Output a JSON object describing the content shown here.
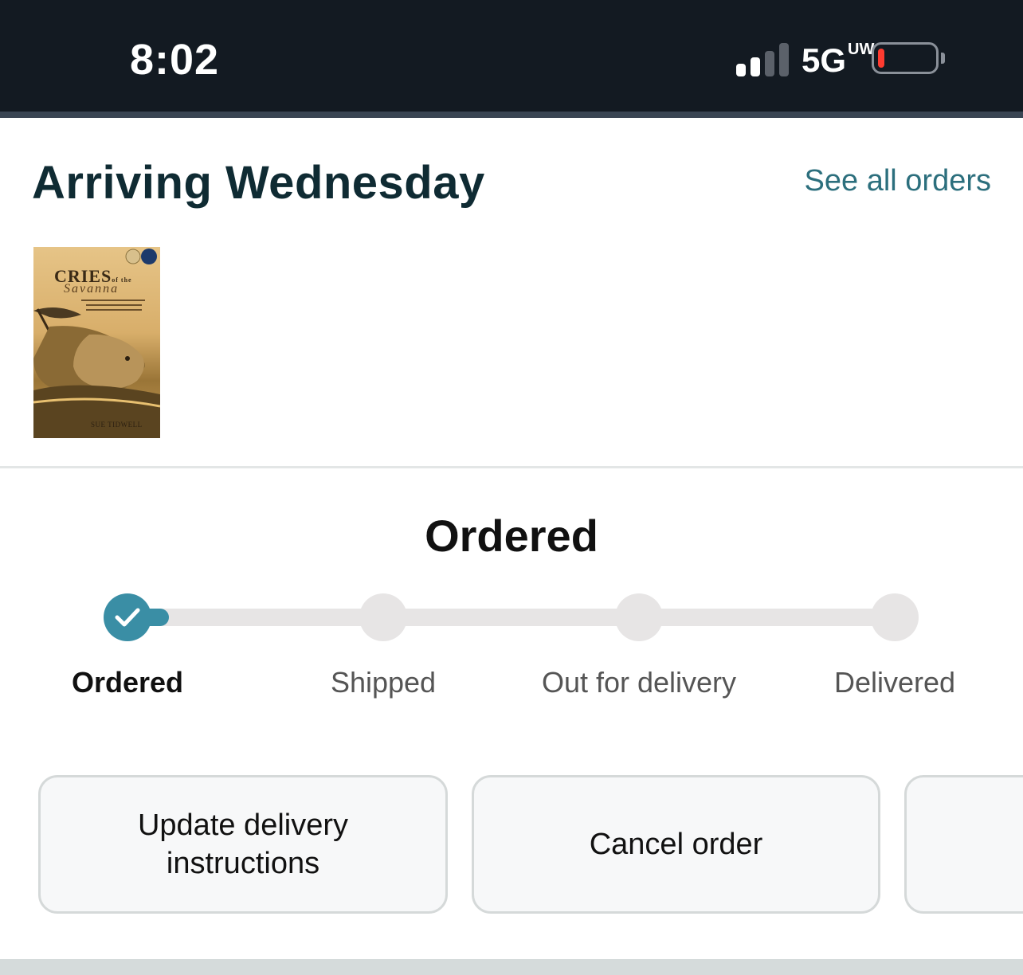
{
  "status_bar": {
    "time": "8:02",
    "network_main": "5G",
    "network_sup": "UW",
    "battery_level": 0.1,
    "battery_color": "#ff3b30"
  },
  "header": {
    "title": "Arriving Wednesday",
    "see_all_link": "See all orders"
  },
  "item": {
    "cover_title": "CRIES",
    "cover_title_small": "of the",
    "cover_subtitle": "Savanna",
    "cover_author": "SUE TIDWELL"
  },
  "tracking": {
    "current_status": "Ordered",
    "steps": [
      {
        "label": "Ordered",
        "completed": true
      },
      {
        "label": "Shipped",
        "completed": false
      },
      {
        "label": "Out for delivery",
        "completed": false
      },
      {
        "label": "Delivered",
        "completed": false
      }
    ],
    "accent_color": "#3a8ea5"
  },
  "actions": {
    "update_delivery": "Update delivery instructions",
    "cancel_order": "Cancel order"
  }
}
